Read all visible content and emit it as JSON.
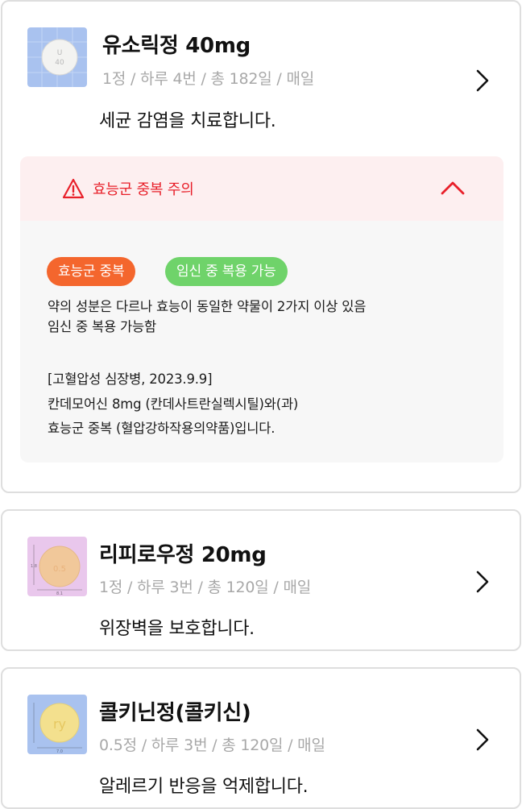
{
  "medications": [
    {
      "name": "유소릭정 40mg",
      "dosage": "1정 / 하루 4번 / 총 182일 / 매일",
      "description": "세균 감염을 치료합니다.",
      "pill_marking": "U 40",
      "thumb_color": "#a9c2ef",
      "warning": {
        "title": "효능군 중복 주의",
        "tags": [
          "효능군 중복",
          "임신 중 복용 가능"
        ],
        "summary_lines": [
          "약의 성분은 다르나 효능이 동일한 약물이 2가지 이상 있음",
          "임신 중 복용 가능함"
        ],
        "detail_lines": [
          "[고혈압성 심장병, 2023.9.9]",
          "칸데모어신 8mg (칸데사트란실렉시틸)와(과)",
          "효능군 중복 (혈압강하작용의약품)입니다."
        ]
      }
    },
    {
      "name": "리피로우정 20mg",
      "dosage": "1정 / 하루 3번 / 총 120일 / 매일",
      "description": "위장벽을 보호합니다.",
      "pill_marking": "0.5",
      "thumb_color": "#e9c7ec"
    },
    {
      "name": "콜키닌정(콜키신)",
      "dosage": "0.5정 / 하루 3번 / 총 120일 / 매일",
      "description": "알레르기 반응을 억제합니다.",
      "pill_marking": "ry",
      "thumb_color": "#a9c2ef"
    }
  ],
  "colors": {
    "warning_red": "#e8202a",
    "tag_orange": "#f4662d",
    "tag_green": "#6fd36a",
    "muted_text": "#a8a8a8"
  }
}
